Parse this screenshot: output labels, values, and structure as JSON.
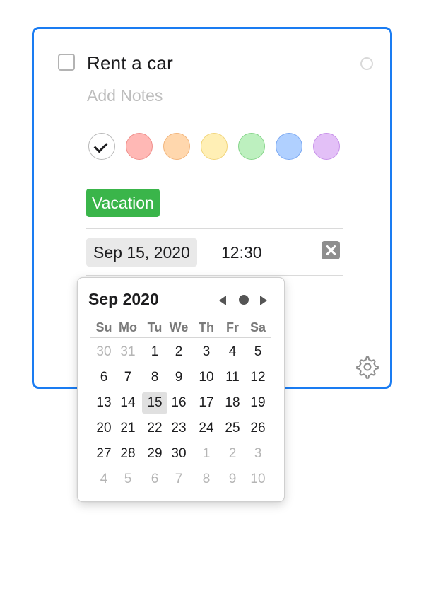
{
  "task": {
    "title": "Rent a car",
    "notes_placeholder": "Add Notes",
    "tag": "Vacation",
    "tag_color": "#3ab54a"
  },
  "colors": [
    {
      "name": "none",
      "selected": true
    },
    {
      "name": "red",
      "fill": "#ffb8b5",
      "border": "#ef8f8c"
    },
    {
      "name": "orange",
      "fill": "#ffd7ad",
      "border": "#f2b57c"
    },
    {
      "name": "yellow",
      "fill": "#ffefb5",
      "border": "#f1d57b"
    },
    {
      "name": "green",
      "fill": "#bdf0bf",
      "border": "#86d58a"
    },
    {
      "name": "blue",
      "fill": "#b0d0ff",
      "border": "#7ca9f2"
    },
    {
      "name": "purple",
      "fill": "#e3c0f7",
      "border": "#c790e9"
    }
  ],
  "due": {
    "date": "Sep 15, 2020",
    "time": "12:30"
  },
  "calendar": {
    "title": "Sep 2020",
    "weekdays": [
      "Su",
      "Mo",
      "Tu",
      "We",
      "Th",
      "Fr",
      "Sa"
    ],
    "days": [
      "30",
      "31",
      "1",
      "2",
      "3",
      "4",
      "5",
      "6",
      "7",
      "8",
      "9",
      "10",
      "11",
      "12",
      "13",
      "14",
      "15",
      "16",
      "17",
      "18",
      "19",
      "20",
      "21",
      "22",
      "23",
      "24",
      "25",
      "26",
      "27",
      "28",
      "29",
      "30",
      "1",
      "2",
      "3",
      "4",
      "5",
      "6",
      "7",
      "8",
      "9",
      "10"
    ],
    "current_month_start": 2,
    "current_month_end": 31,
    "selected_index": 16
  },
  "accent_color": "#1a7cf2"
}
